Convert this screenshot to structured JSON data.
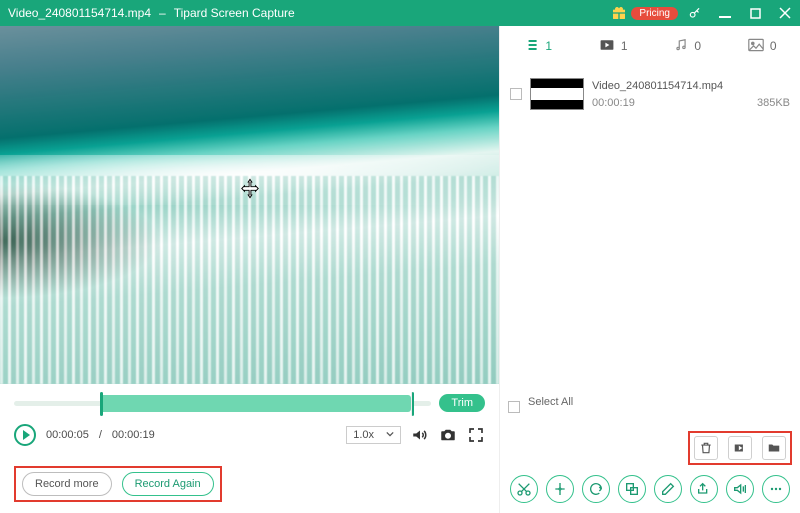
{
  "titlebar": {
    "filename": "Video_240801154714.mp4",
    "separator": "–",
    "appname": "Tipard Screen Capture",
    "pricing_label": "Pricing"
  },
  "trim": {
    "label": "Trim"
  },
  "playback": {
    "current_time": "00:00:05",
    "total_time": "00:00:19",
    "speed": "1.0x"
  },
  "record": {
    "more_label": "Record more",
    "again_label": "Record Again"
  },
  "tabs": {
    "list_count": "1",
    "video_count": "1",
    "audio_count": "0",
    "image_count": "0"
  },
  "file": {
    "name": "Video_240801154714.mp4",
    "duration": "00:00:19",
    "size": "385KB"
  },
  "select_all_label": "Select All"
}
